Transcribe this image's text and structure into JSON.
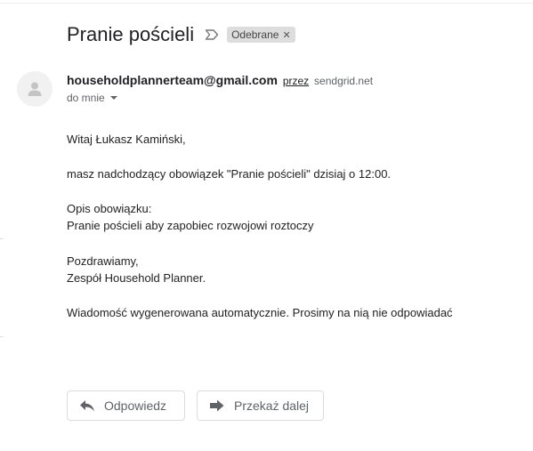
{
  "message": {
    "subject": "Pranie pościeli",
    "label": "Odebrane",
    "sender_email": "householdplannerteam@gmail.com",
    "via_label": "przez",
    "via_domain": "sendgrid.net",
    "recipient": "do mnie",
    "body": {
      "greeting": "Witaj  Łukasz Kamiński,",
      "line1": "masz nadchodzący obowiązek \"Pranie pościeli\" dzisiaj o 12:00.",
      "desc_heading": "Opis obowiązku:",
      "desc_text": "Pranie pościeli aby zapobiec rozwojowi roztoczy",
      "closing": "Pozdrawiamy,",
      "signature": "Zespół Household Planner.",
      "footer": "Wiadomość wygenerowana automatycznie. Prosimy na nią nie odpowiadać"
    }
  },
  "actions": {
    "reply_label": "Odpowiedz",
    "forward_label": "Przekaż dalej"
  },
  "icons": {
    "importance": "importance-marker-icon",
    "label_remove": "close-icon",
    "avatar": "person-icon",
    "reply": "reply-arrow-icon",
    "forward": "forward-arrow-icon"
  }
}
